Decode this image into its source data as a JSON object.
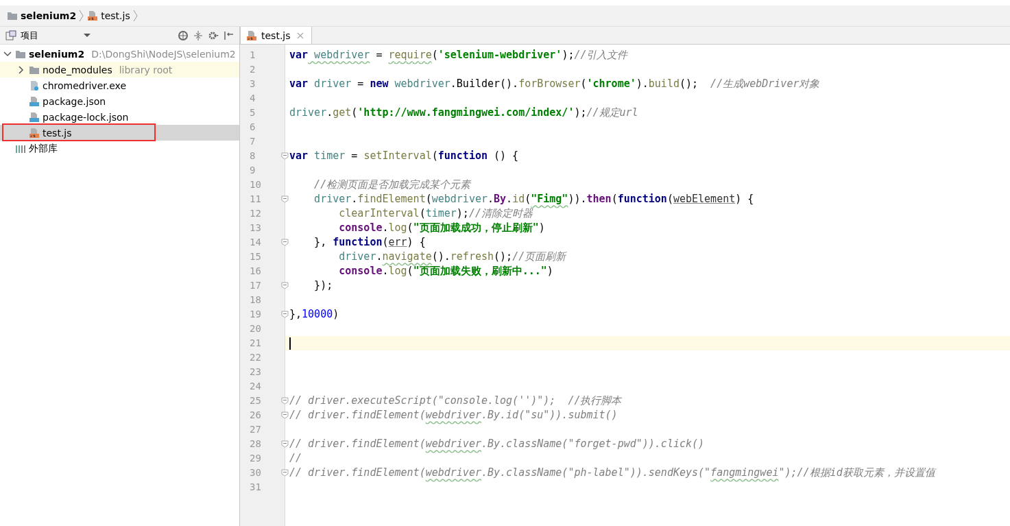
{
  "breadcrumb": [
    {
      "kind": "folder",
      "label": "selenium2"
    },
    {
      "kind": "js",
      "label": "test.js"
    }
  ],
  "project_panel": {
    "title": "项目",
    "tree": [
      {
        "kind": "folder",
        "label": "selenium2",
        "hint": "D:\\DongShi\\NodeJS\\selenium2",
        "expanded": true,
        "selected": false,
        "children": [
          {
            "kind": "library-folder",
            "label": "node_modules",
            "hint": "library root",
            "expanded": false,
            "selected": false
          },
          {
            "kind": "exe",
            "label": "chromedriver.exe",
            "selected": false
          },
          {
            "kind": "json",
            "label": "package.json",
            "selected": false
          },
          {
            "kind": "json",
            "label": "package-lock.json",
            "selected": false
          },
          {
            "kind": "js",
            "label": "test.js",
            "selected": true,
            "outlined": true
          }
        ]
      },
      {
        "kind": "libraries",
        "label": "外部库",
        "selected": false
      }
    ]
  },
  "tabs": [
    {
      "label": "test.js",
      "selected": true
    }
  ],
  "editor": {
    "lines": [
      {
        "number": "1",
        "tokens": [
          {
            "kind": "keyword",
            "text": "var"
          },
          {
            "kind": "variable",
            "text": " webdriver",
            "warning": true
          },
          {
            "kind": "plain",
            "text": " = "
          },
          {
            "kind": "function",
            "text": "require",
            "warning": true
          },
          {
            "kind": "plain",
            "text": "("
          },
          {
            "kind": "string",
            "text": "'selenium-webdriver'"
          },
          {
            "kind": "plain",
            "text": ");"
          },
          {
            "kind": "comment",
            "text": "//引入文件"
          }
        ]
      },
      {
        "number": "2"
      },
      {
        "number": "3",
        "tokens": [
          {
            "kind": "keyword",
            "text": "var"
          },
          {
            "kind": "variable",
            "text": " driver"
          },
          {
            "kind": "plain",
            "text": " = "
          },
          {
            "kind": "keyword",
            "text": "new"
          },
          {
            "kind": "variable",
            "text": " webdriver"
          },
          {
            "kind": "plain",
            "text": ".Builder()."
          },
          {
            "kind": "function",
            "text": "forBrowser"
          },
          {
            "kind": "plain",
            "text": "("
          },
          {
            "kind": "string",
            "text": "'chrome'"
          },
          {
            "kind": "plain",
            "text": ")."
          },
          {
            "kind": "function",
            "text": "build"
          },
          {
            "kind": "plain",
            "text": "();"
          },
          {
            "kind": "comment",
            "text": "  //生成webDriver对象"
          }
        ]
      },
      {
        "number": "4"
      },
      {
        "number": "5",
        "tokens": [
          {
            "kind": "variable",
            "text": "driver"
          },
          {
            "kind": "plain",
            "text": "."
          },
          {
            "kind": "function",
            "text": "get"
          },
          {
            "kind": "plain",
            "text": "("
          },
          {
            "kind": "string",
            "text": "'http://www.fangmingwei.com/index/'"
          },
          {
            "kind": "plain",
            "text": ");"
          },
          {
            "kind": "comment",
            "text": "//规定url"
          }
        ]
      },
      {
        "number": "6"
      },
      {
        "number": "7"
      },
      {
        "number": "8",
        "fold": true,
        "tokens": [
          {
            "kind": "keyword",
            "text": "var"
          },
          {
            "kind": "variable",
            "text": " timer"
          },
          {
            "kind": "plain",
            "text": " = "
          },
          {
            "kind": "function",
            "text": "setInterval"
          },
          {
            "kind": "plain",
            "text": "("
          },
          {
            "kind": "keyword",
            "text": "function"
          },
          {
            "kind": "plain",
            "text": " () {"
          }
        ]
      },
      {
        "number": "9"
      },
      {
        "number": "10",
        "tokens": [
          {
            "kind": "comment",
            "text": "    //检测页面是否加载完成某个元素"
          }
        ]
      },
      {
        "number": "11",
        "fold": true,
        "tokens": [
          {
            "kind": "variable",
            "text": "    driver"
          },
          {
            "kind": "plain",
            "text": "."
          },
          {
            "kind": "function",
            "text": "findElement"
          },
          {
            "kind": "plain",
            "text": "("
          },
          {
            "kind": "variable",
            "text": "webdriver"
          },
          {
            "kind": "plain",
            "text": "."
          },
          {
            "kind": "member",
            "text": "By"
          },
          {
            "kind": "plain",
            "text": "."
          },
          {
            "kind": "function",
            "text": "id"
          },
          {
            "kind": "plain",
            "text": "("
          },
          {
            "kind": "string",
            "text": "\"Fimg\"",
            "warning": true
          },
          {
            "kind": "plain",
            "text": "))."
          },
          {
            "kind": "member",
            "text": "then"
          },
          {
            "kind": "plain",
            "text": "("
          },
          {
            "kind": "keyword",
            "text": "function"
          },
          {
            "kind": "plain",
            "text": "("
          },
          {
            "kind": "param",
            "text": "webElement"
          },
          {
            "kind": "plain",
            "text": ") {"
          }
        ]
      },
      {
        "number": "12",
        "tokens": [
          {
            "kind": "function",
            "text": "        clearInterval"
          },
          {
            "kind": "plain",
            "text": "("
          },
          {
            "kind": "variable",
            "text": "timer"
          },
          {
            "kind": "plain",
            "text": ");"
          },
          {
            "kind": "comment",
            "text": "//清除定时器"
          }
        ]
      },
      {
        "number": "13",
        "tokens": [
          {
            "kind": "member",
            "text": "        console"
          },
          {
            "kind": "plain",
            "text": "."
          },
          {
            "kind": "function",
            "text": "log"
          },
          {
            "kind": "plain",
            "text": "("
          },
          {
            "kind": "string",
            "text": "\"页面加载成功，停止刷新\""
          },
          {
            "kind": "plain",
            "text": ")"
          }
        ]
      },
      {
        "number": "14",
        "fold": true,
        "tokens": [
          {
            "kind": "plain",
            "text": "    }, "
          },
          {
            "kind": "keyword",
            "text": "function"
          },
          {
            "kind": "plain",
            "text": "("
          },
          {
            "kind": "param",
            "text": "err"
          },
          {
            "kind": "plain",
            "text": ") {"
          }
        ]
      },
      {
        "number": "15",
        "tokens": [
          {
            "kind": "variable",
            "text": "        driver"
          },
          {
            "kind": "plain",
            "text": "."
          },
          {
            "kind": "function",
            "text": "navigate",
            "warning": true
          },
          {
            "kind": "plain",
            "text": "()."
          },
          {
            "kind": "function",
            "text": "refresh"
          },
          {
            "kind": "plain",
            "text": "();"
          },
          {
            "kind": "comment",
            "text": "//页面刷新"
          }
        ]
      },
      {
        "number": "16",
        "tokens": [
          {
            "kind": "member",
            "text": "        console"
          },
          {
            "kind": "plain",
            "text": "."
          },
          {
            "kind": "function",
            "text": "log"
          },
          {
            "kind": "plain",
            "text": "("
          },
          {
            "kind": "string",
            "text": "\"页面加载失败，刷新中...\""
          },
          {
            "kind": "plain",
            "text": ")"
          }
        ]
      },
      {
        "number": "17",
        "fold": true,
        "tokens": [
          {
            "kind": "plain",
            "text": "    });"
          }
        ]
      },
      {
        "number": "18"
      },
      {
        "number": "19",
        "fold": true,
        "tokens": [
          {
            "kind": "plain",
            "text": "},"
          },
          {
            "kind": "number",
            "text": "10000"
          },
          {
            "kind": "plain",
            "text": ")"
          }
        ]
      },
      {
        "number": "20"
      },
      {
        "number": "21",
        "current": true
      },
      {
        "number": "22"
      },
      {
        "number": "23"
      },
      {
        "number": "24"
      },
      {
        "number": "25",
        "fold": true,
        "tokens": [
          {
            "kind": "comment",
            "text": "// driver.executeScript(\"console.log('')\");  //执行脚本"
          }
        ]
      },
      {
        "number": "26",
        "fold": true,
        "tokens": [
          {
            "kind": "comment",
            "text": "// driver.findElement("
          },
          {
            "kind": "comment",
            "text": "webdriver",
            "warning": true
          },
          {
            "kind": "comment",
            "text": ".By.id(\"su\")).submit()"
          }
        ]
      },
      {
        "number": "27"
      },
      {
        "number": "28",
        "fold": true,
        "tokens": [
          {
            "kind": "comment",
            "text": "// driver.findElement("
          },
          {
            "kind": "comment",
            "text": "webdriver",
            "warning": true
          },
          {
            "kind": "comment",
            "text": ".By.className(\"forget-pwd\")).click()"
          }
        ]
      },
      {
        "number": "29",
        "tokens": [
          {
            "kind": "comment",
            "text": "//"
          }
        ]
      },
      {
        "number": "30",
        "fold": true,
        "tokens": [
          {
            "kind": "comment",
            "text": "// driver.findElement("
          },
          {
            "kind": "comment",
            "text": "webdriver",
            "warning": true
          },
          {
            "kind": "comment",
            "text": ".By.className(\"ph-label\")).sendKeys(\""
          },
          {
            "kind": "comment",
            "text": "fangmingwei",
            "warning": true
          },
          {
            "kind": "comment",
            "text": "\");//根据id获取元素，并设置值"
          }
        ]
      },
      {
        "number": "31"
      }
    ]
  }
}
